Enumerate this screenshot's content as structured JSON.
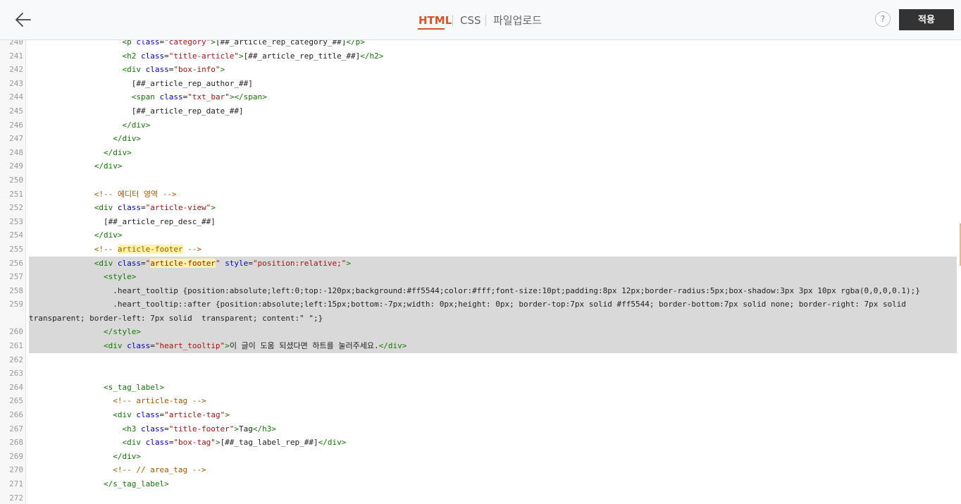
{
  "header": {
    "tabs": [
      {
        "label": "HTML",
        "active": true
      },
      {
        "label": "CSS",
        "active": false
      },
      {
        "label": "파일업로드",
        "active": false
      }
    ],
    "help_label": "?",
    "apply_label": "적용"
  },
  "colors": {
    "accent": "#d9532a",
    "selection": "#d9d9d9",
    "search_highlight": "#fff3a8"
  },
  "editor": {
    "lines": [
      {
        "n": "240",
        "text": "                    <p class=\"category\">[##_article_rep_category_##]</p>"
      },
      {
        "n": "241",
        "text": "                    <h2 class=\"title-article\">[##_article_rep_title_##]</h2>"
      },
      {
        "n": "242",
        "text": "                    <div class=\"box-info\">"
      },
      {
        "n": "243",
        "text": "                      [##_article_rep_author_##]"
      },
      {
        "n": "244",
        "text": "                      <span class=\"txt_bar\"></span>"
      },
      {
        "n": "245",
        "text": "                      [##_article_rep_date_##]"
      },
      {
        "n": "246",
        "text": "                    </div>"
      },
      {
        "n": "247",
        "text": "                  </div>"
      },
      {
        "n": "248",
        "text": "                </div>"
      },
      {
        "n": "249",
        "text": "              </div>"
      },
      {
        "n": "250",
        "text": ""
      },
      {
        "n": "251",
        "text": "              <!-- 에디터 영역 -->"
      },
      {
        "n": "252",
        "text": "              <div class=\"article-view\">"
      },
      {
        "n": "253",
        "text": "                [##_article_rep_desc_##]"
      },
      {
        "n": "254",
        "text": "              </div>"
      },
      {
        "n": "255",
        "text": "              <!-- article-footer -->"
      },
      {
        "n": "256",
        "text": "              <div class=\"article-footer\" style=\"position:relative;\">"
      },
      {
        "n": "257",
        "text": "                <style>"
      },
      {
        "n": "258",
        "text": "                  .heart_tooltip {position:absolute;left:0;top:-120px;background:#ff5544;color:#fff;font-size:10pt;padding:8px 12px;border-radius:5px;box-shadow:3px 3px 10px rgba(0,0,0,0.1);}"
      },
      {
        "n": "259",
        "text": "                  .heart_tooltip::after {position:absolute;left:15px;bottom:-7px;width: 0px;height: 0px; border-top:7px solid #ff5544; border-bottom:7px solid none; border-right: 7px solid transparent; border-left: 7px solid  transparent; content:\" \";}"
      },
      {
        "n": "260",
        "text": "                </style>"
      },
      {
        "n": "261",
        "text": "                <div class=\"heart_tooltip\">이 글이 도움 되셨다면 하트를 눌러주세요.</div>"
      },
      {
        "n": "262",
        "text": ""
      },
      {
        "n": "263",
        "text": ""
      },
      {
        "n": "264",
        "text": "                <s_tag_label>"
      },
      {
        "n": "265",
        "text": "                  <!-- article-tag -->"
      },
      {
        "n": "266",
        "text": "                  <div class=\"article-tag\">"
      },
      {
        "n": "267",
        "text": "                    <h3 class=\"title-footer\">Tag</h3>"
      },
      {
        "n": "268",
        "text": "                    <div class=\"box-tag\">[##_tag_label_rep_##]</div>"
      },
      {
        "n": "269",
        "text": "                  </div>"
      },
      {
        "n": "270",
        "text": "                  <!-- // area_tag -->"
      },
      {
        "n": "271",
        "text": "                </s_tag_label>"
      },
      {
        "n": "272",
        "text": ""
      }
    ]
  }
}
